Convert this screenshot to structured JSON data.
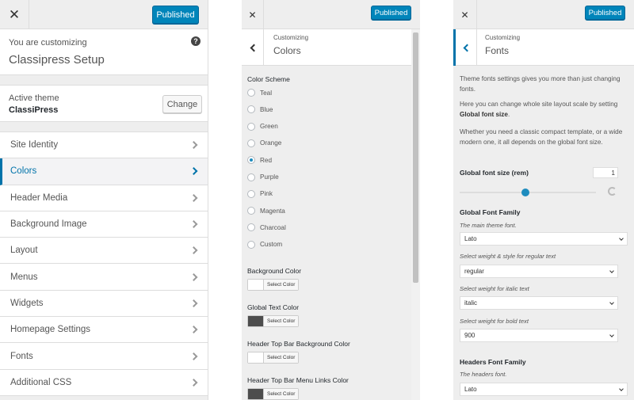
{
  "panel1": {
    "publish_label": "Published",
    "customizing_label": "You are customizing",
    "site_title": "Classipress Setup",
    "active_theme_label": "Active theme",
    "theme_name": "ClassiPress",
    "change_label": "Change",
    "menu": [
      {
        "label": "Site Identity"
      },
      {
        "label": "Colors"
      },
      {
        "label": "Header Media"
      },
      {
        "label": "Background Image"
      },
      {
        "label": "Layout"
      },
      {
        "label": "Menus"
      },
      {
        "label": "Widgets"
      },
      {
        "label": "Homepage Settings"
      },
      {
        "label": "Fonts"
      },
      {
        "label": "Additional CSS"
      }
    ],
    "active_item": "Colors"
  },
  "panel2": {
    "publish_label": "Published",
    "breadcrumb": "Customizing",
    "section_title": "Colors",
    "color_scheme_label": "Color Scheme",
    "schemes": [
      "Teal",
      "Blue",
      "Green",
      "Orange",
      "Red",
      "Purple",
      "Pink",
      "Magenta",
      "Charcoal",
      "Custom"
    ],
    "selected_scheme": "Red",
    "color_controls": [
      {
        "label": "Background Color",
        "button": "Select Color",
        "swatch": "#ffffff"
      },
      {
        "label": "Global Text Color",
        "button": "Select Color",
        "swatch": "#4d4d4d"
      },
      {
        "label": "Header Top Bar Background Color",
        "button": "Select Color",
        "swatch": "#ffffff"
      },
      {
        "label": "Header Top Bar Menu Links Color",
        "button": "Select Color",
        "swatch": "#4d4d4d"
      }
    ]
  },
  "panel3": {
    "publish_label": "Published",
    "breadcrumb": "Customizing",
    "section_title": "Fonts",
    "desc1": "Theme fonts settings gives you more than just changing fonts.",
    "desc2_prefix": "Here you can change whole site layout scale by setting ",
    "desc2_bold": "Global font size",
    "desc2_suffix": ".",
    "desc3": "Whether you need a classic compact template, or a wide modern one, it all depends on the global font size.",
    "global_size_label": "Global font size (rem)",
    "global_size_value": "1",
    "slider_fraction": 0.48,
    "global_family_label": "Global Font Family",
    "global_family_hint": "The main theme font.",
    "global_family_value": "Lato",
    "regular_hint": "Select weight & style for regular text",
    "regular_value": "regular",
    "italic_hint": "Select weight for italic text",
    "italic_value": "italic",
    "bold_hint": "Select weight for bold text",
    "bold_value": "900",
    "headers_family_label": "Headers Font Family",
    "headers_family_hint": "The headers font.",
    "headers_family_value": "Lato"
  },
  "colors": {
    "accent": "#0073aa",
    "publish_bg": "#0085ba",
    "radio_dot": "#1e8cbe"
  },
  "icons": {
    "close": "close-icon",
    "help": "help-icon",
    "chevron": "chevron-right-icon",
    "back": "chevron-left-icon",
    "reset": "reset-icon"
  }
}
